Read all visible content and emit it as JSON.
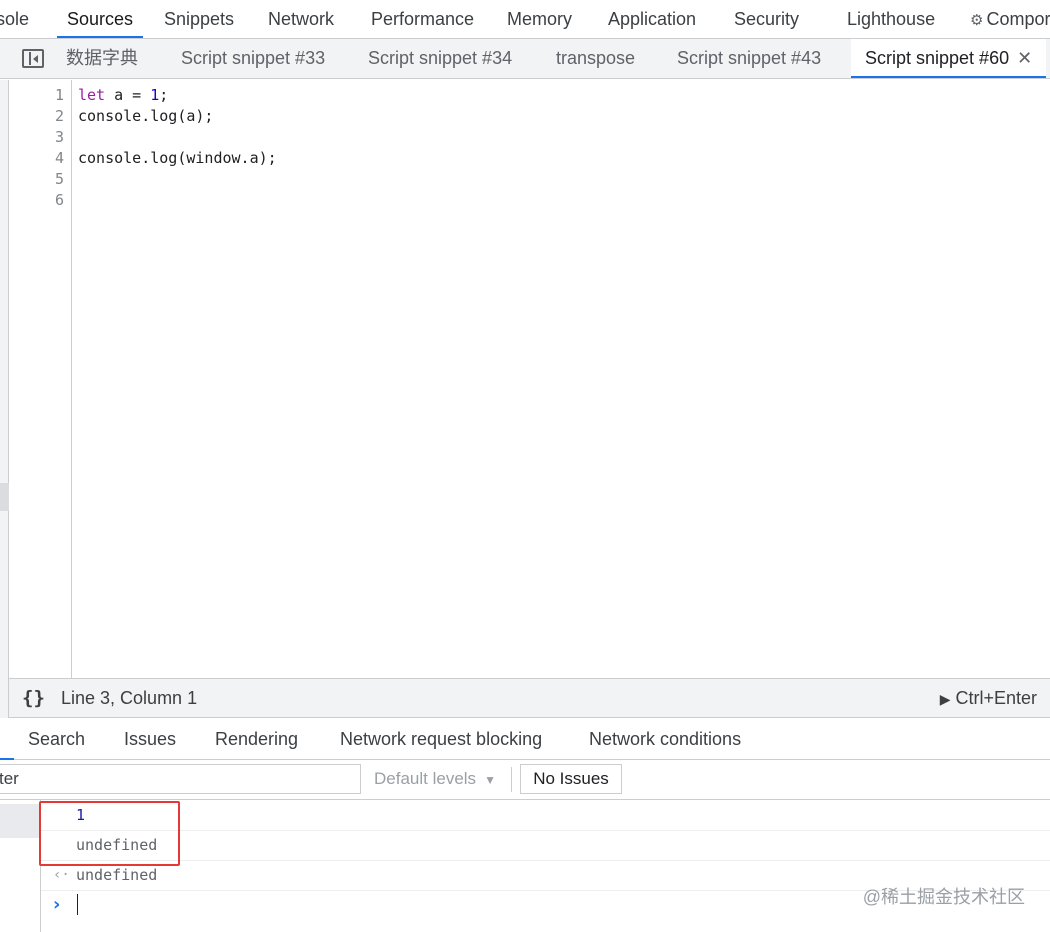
{
  "panel_tabs": [
    {
      "label": "sole",
      "active": false
    },
    {
      "label": "Sources",
      "active": true
    },
    {
      "label": "Snippets",
      "active": false
    },
    {
      "label": "Network",
      "active": false
    },
    {
      "label": "Performance",
      "active": false
    },
    {
      "label": "Memory",
      "active": false
    },
    {
      "label": "Application",
      "active": false
    },
    {
      "label": "Security",
      "active": false
    },
    {
      "label": "Lighthouse",
      "active": false
    },
    {
      "label": "Compor",
      "active": false,
      "icon": "gear-icon"
    }
  ],
  "file_tabs": [
    {
      "label": "数据字典",
      "active": false
    },
    {
      "label": "Script snippet #33",
      "active": false
    },
    {
      "label": "Script snippet #34",
      "active": false
    },
    {
      "label": "transpose",
      "active": false
    },
    {
      "label": "Script snippet #43",
      "active": false
    },
    {
      "label": "Script snippet #60",
      "active": true,
      "close": "✕"
    }
  ],
  "editor": {
    "line_numbers": [
      "1",
      "2",
      "3",
      "4",
      "5",
      "6"
    ],
    "lines": {
      "l1": {
        "kw": "let",
        "mid": " a = ",
        "num": "1",
        "end": ";"
      },
      "l2": "console.log(a);",
      "l3": "",
      "l4": "console.log(window.a);"
    }
  },
  "status": {
    "format_icon": "{}",
    "cursor_position": "Line 3, Column 1",
    "run_hint": "Ctrl+Enter"
  },
  "drawer_tabs": [
    "Search",
    "Issues",
    "Rendering",
    "Network request blocking",
    "Network conditions"
  ],
  "filter": {
    "input_value": "ter",
    "levels_label": "Default levels",
    "issues_label": "No Issues"
  },
  "console": {
    "messages": [
      {
        "text": "1",
        "type": "log-number"
      },
      {
        "text": "undefined",
        "type": "log-undefined"
      },
      {
        "text": "undefined",
        "type": "result",
        "icon": "‹·"
      }
    ],
    "prompt": "›"
  },
  "watermark": "@稀土掘金技术社区",
  "colors": {
    "accent": "#1a73e8",
    "highlight_box": "#e53935",
    "keyword": "#9a1ea1",
    "number": "#1c00cf"
  }
}
